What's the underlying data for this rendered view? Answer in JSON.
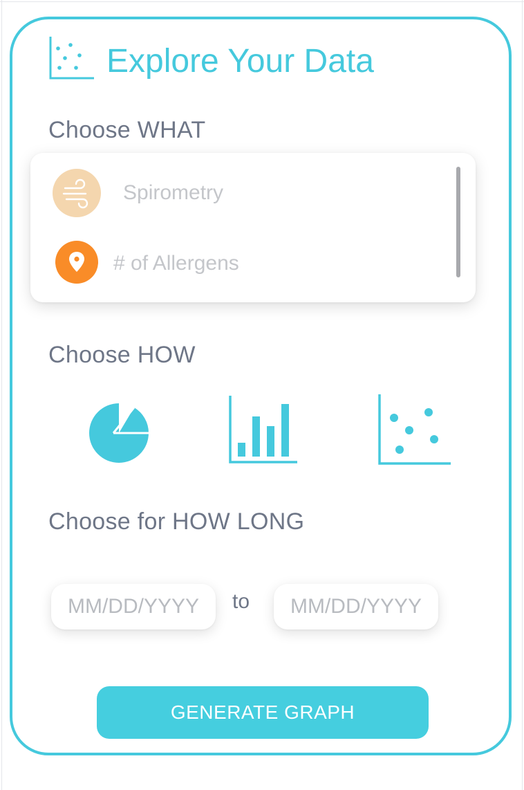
{
  "header": {
    "title": "Explore Your Data",
    "icon": "scatter-plot-icon"
  },
  "what_section": {
    "label": "Choose WHAT",
    "options": [
      {
        "label": "Spirometry",
        "icon": "wind-icon",
        "icon_bg": "#f4d6ae",
        "icon_color": "#ffffff"
      },
      {
        "label": "# of Allergens",
        "icon": "location-pin-icon",
        "icon_bg": "#f98c28",
        "icon_color": "#ffffff"
      }
    ]
  },
  "how_section": {
    "label": "Choose HOW",
    "chart_types": [
      {
        "icon": "pie-chart-icon"
      },
      {
        "icon": "bar-chart-icon"
      },
      {
        "icon": "scatter-plot-icon"
      }
    ]
  },
  "how_long_section": {
    "label": "Choose for HOW LONG",
    "start_placeholder": "MM/DD/YYYY",
    "start_value": "",
    "separator": "to",
    "end_placeholder": "MM/DD/YYYY",
    "end_value": ""
  },
  "generate_button": {
    "label": "GENERATE GRAPH"
  },
  "colors": {
    "accent": "#45c9dd",
    "text_muted": "#6e7687",
    "placeholder": "#b8bbc0",
    "spirometry_bg": "#f4d6ae",
    "allergens_bg": "#f98c28"
  }
}
